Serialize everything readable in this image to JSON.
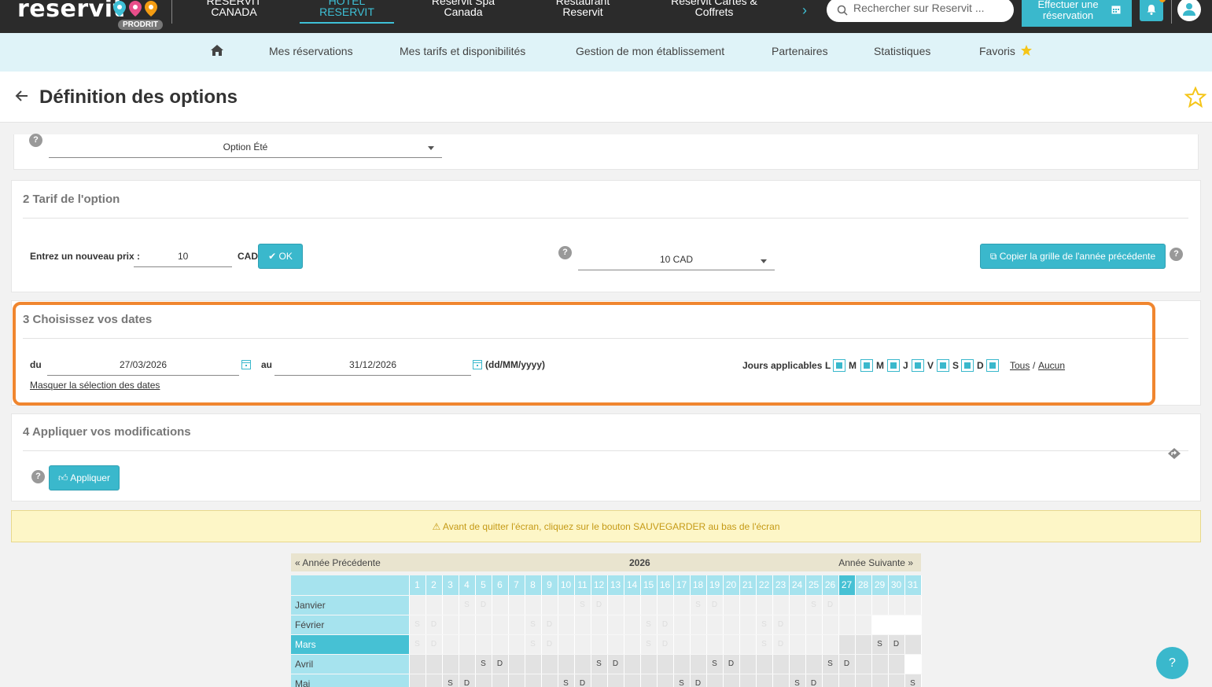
{
  "topbar": {
    "logo": "reservit",
    "badge": "PRODRIT",
    "tabs": [
      {
        "line1": "RESERVIT",
        "line2": "CANADA"
      },
      {
        "line1": "HOTEL",
        "line2": "RESERVIT"
      },
      {
        "line1": "Reservit Spa",
        "line2": "Canada"
      },
      {
        "line1": "Restaurant",
        "line2": "Reservit"
      },
      {
        "line1": "Reservit Cartes &",
        "line2": "Coffrets"
      }
    ],
    "search_placeholder": "Rechercher sur Reservit ...",
    "book_button": {
      "line1": "Effectuer une",
      "line2": "réservation"
    }
  },
  "subnav": {
    "items": [
      "Mes réservations",
      "Mes tarifs et disponibilités",
      "Gestion de mon établissement",
      "Partenaires",
      "Statistiques",
      "Favoris"
    ]
  },
  "page": {
    "title": "Définition des options"
  },
  "section1": {
    "selected_option": "Option Été"
  },
  "section2": {
    "title": "2 Tarif de l'option",
    "price_label": "Entrez un nouveau prix :",
    "price_value": "10",
    "currency": "CAD",
    "ok_label": "OK",
    "price_select": "10 CAD",
    "copy_button": "Copier la grille de l'année précédente"
  },
  "section3": {
    "title": "3 Choisissez vos dates",
    "from_label": "du",
    "from_value": "27/03/2026",
    "to_label": "au",
    "to_value": "31/12/2026",
    "format_hint": "(dd/MM/yyyy)",
    "days_label": "Jours applicables :",
    "days": [
      "L",
      "M",
      "M",
      "J",
      "V",
      "S",
      "D"
    ],
    "all_link": "Tous",
    "separator": "/",
    "none_link": "Aucun",
    "hide_link": "Masquer la sélection des dates"
  },
  "section4": {
    "title": "4 Appliquer vos modifications",
    "apply_button": "Appliquer"
  },
  "alert": {
    "text": "Avant de quitter l'écran, cliquez sur le bouton SAUVEGARDER au bas de l'écran"
  },
  "calendar": {
    "prev": "« Année Précédente",
    "year": "2026",
    "next": "Année Suivante »",
    "months": [
      {
        "name": "Janvier",
        "first_weekday": 3,
        "days": 31
      },
      {
        "name": "Février",
        "first_weekday": 6,
        "days": 28
      },
      {
        "name": "Mars",
        "first_weekday": 6,
        "days": 31
      },
      {
        "name": "Avril",
        "first_weekday": 2,
        "days": 30
      },
      {
        "name": "Mai",
        "first_weekday": 4,
        "days": 31
      }
    ],
    "selected_day": 27,
    "selected_month": "Mars",
    "weekend_letters": [
      "S",
      "D"
    ]
  },
  "help_fab": "?",
  "colors": {
    "accent": "#3ab8cc",
    "highlight": "#f0862f",
    "topbar": "#2b2b2b"
  }
}
